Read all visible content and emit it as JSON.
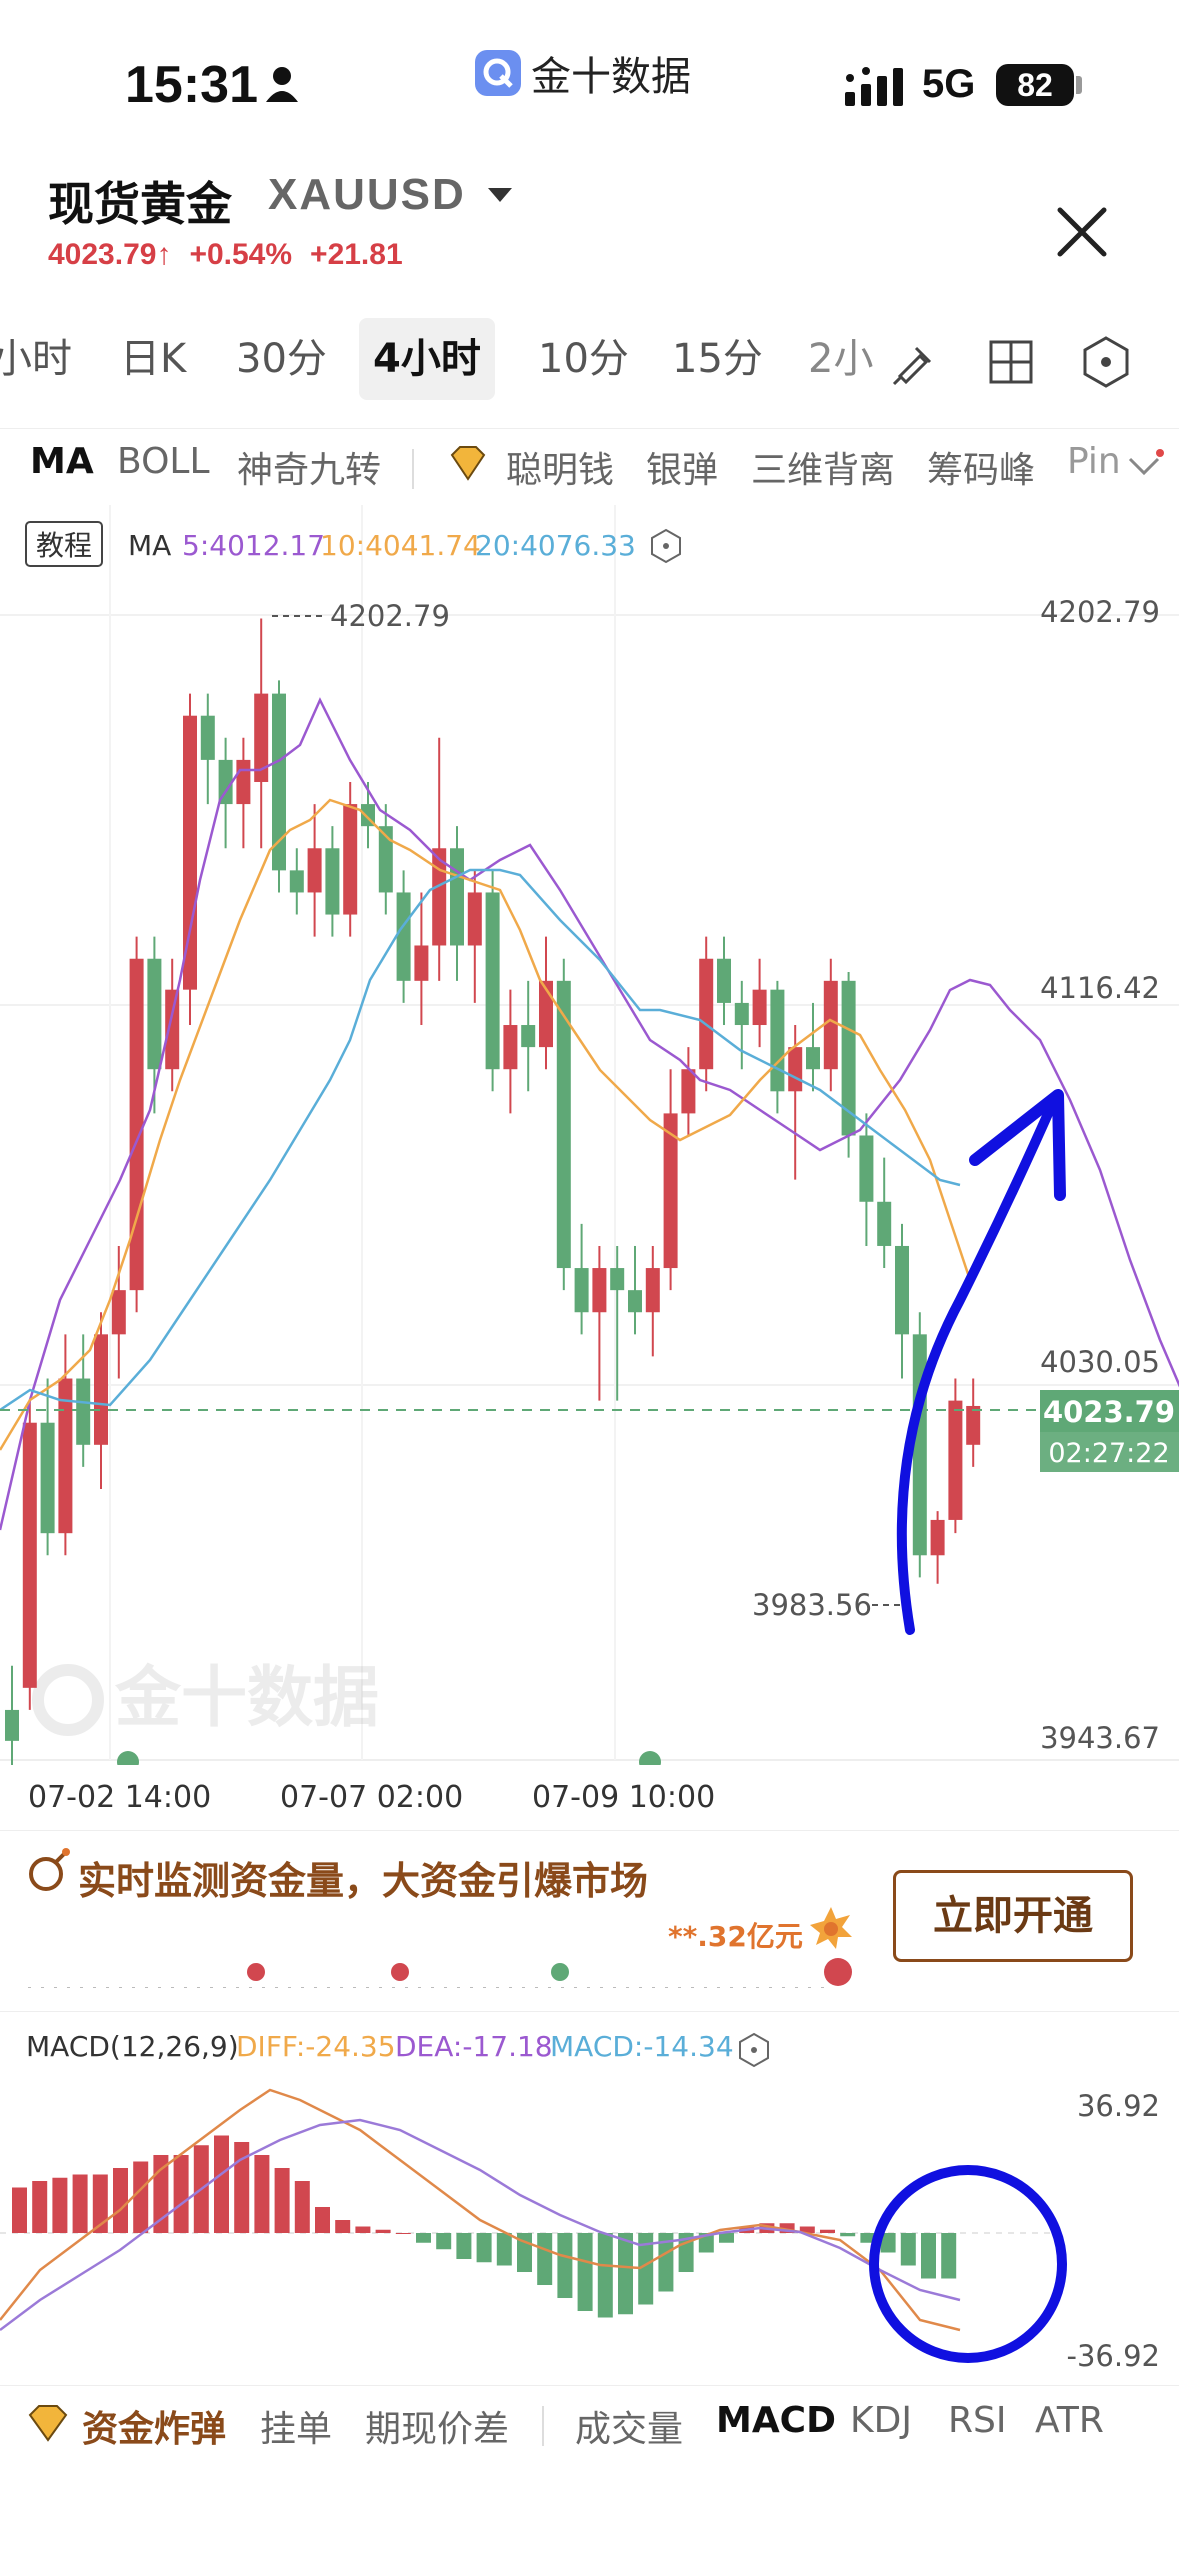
{
  "status": {
    "time": "15:31",
    "network": "5G",
    "battery": "82"
  },
  "app": {
    "name": "金十数据"
  },
  "header": {
    "title": "现货黄金",
    "symbol": "XAUUSD",
    "price": "4023.79",
    "change_pct": "+0.54%",
    "change_abs": "+21.81"
  },
  "period_tabs": [
    "小时",
    "日K",
    "30分",
    "4小时",
    "10分",
    "15分",
    "2小"
  ],
  "active_period": "4小时",
  "indicator_tabs": [
    "MA",
    "BOLL",
    "神奇九转",
    "聪明钱",
    "银弹",
    "三维背离",
    "筹码峰",
    "Pin"
  ],
  "ma_legend": {
    "tutorial": "教程",
    "label": "MA",
    "ma5": "5:4012.17",
    "ma10": "10:4041.74",
    "ma20": "20:4076.33"
  },
  "price_axis": [
    "4202.79",
    "4116.42",
    "4030.05",
    "3943.67"
  ],
  "high_marker": "4202.79",
  "low_marker": "3983.56",
  "current_price_tag": "4023.79",
  "countdown_tag": "02:27:22",
  "watermark": "金十数据",
  "x_axis": [
    "07-02 14:00",
    "07-07 02:00",
    "07-09 10:00"
  ],
  "promo": {
    "text": "实时监测资金量，大资金引爆市场",
    "amount": "**.32亿元",
    "button": "立即开通"
  },
  "macd_legend": {
    "label": "MACD(12,26,9)",
    "diff": "DIFF:-24.35",
    "dea": "DEA:-17.18",
    "macd": "MACD:-14.34"
  },
  "macd_axis": [
    "36.92",
    "-36.92"
  ],
  "bottom_tabs": [
    "资金炸弹",
    "挂单",
    "期现价差",
    "成交量",
    "MACD",
    "KDJ",
    "RSI",
    "ATR"
  ],
  "colors": {
    "up": "#d1474f",
    "down": "#5fa876",
    "ma5": "#9b59d0",
    "ma10": "#f0a94a",
    "ma20": "#5aaed8",
    "annotation": "#1010e0"
  },
  "chart_data": {
    "type": "candlestick",
    "ylim": [
      3943.67,
      4202.79
    ],
    "candles": [
      {
        "o": 3955,
        "h": 3965,
        "l": 3935,
        "c": 3948
      },
      {
        "o": 3960,
        "h": 4025,
        "l": 3955,
        "c": 4020
      },
      {
        "o": 4020,
        "h": 4030,
        "l": 3990,
        "c": 3995
      },
      {
        "o": 3995,
        "h": 4040,
        "l": 3990,
        "c": 4030
      },
      {
        "o": 4030,
        "h": 4040,
        "l": 4010,
        "c": 4015
      },
      {
        "o": 4015,
        "h": 4045,
        "l": 4005,
        "c": 4040
      },
      {
        "o": 4040,
        "h": 4060,
        "l": 4030,
        "c": 4050
      },
      {
        "o": 4050,
        "h": 4130,
        "l": 4045,
        "c": 4125
      },
      {
        "o": 4125,
        "h": 4130,
        "l": 4090,
        "c": 4100
      },
      {
        "o": 4100,
        "h": 4125,
        "l": 4095,
        "c": 4118
      },
      {
        "o": 4118,
        "h": 4185,
        "l": 4110,
        "c": 4180
      },
      {
        "o": 4180,
        "h": 4185,
        "l": 4160,
        "c": 4170
      },
      {
        "o": 4170,
        "h": 4175,
        "l": 4150,
        "c": 4160
      },
      {
        "o": 4160,
        "h": 4175,
        "l": 4150,
        "c": 4170
      },
      {
        "o": 4165,
        "h": 4202,
        "l": 4150,
        "c": 4185
      },
      {
        "o": 4185,
        "h": 4188,
        "l": 4140,
        "c": 4145
      },
      {
        "o": 4145,
        "h": 4150,
        "l": 4135,
        "c": 4140
      },
      {
        "o": 4140,
        "h": 4160,
        "l": 4130,
        "c": 4150
      },
      {
        "o": 4150,
        "h": 4155,
        "l": 4130,
        "c": 4135
      },
      {
        "o": 4135,
        "h": 4165,
        "l": 4130,
        "c": 4160
      },
      {
        "o": 4160,
        "h": 4165,
        "l": 4150,
        "c": 4155
      },
      {
        "o": 4155,
        "h": 4160,
        "l": 4135,
        "c": 4140
      },
      {
        "o": 4140,
        "h": 4145,
        "l": 4115,
        "c": 4120
      },
      {
        "o": 4120,
        "h": 4140,
        "l": 4110,
        "c": 4128
      },
      {
        "o": 4128,
        "h": 4175,
        "l": 4120,
        "c": 4150
      },
      {
        "o": 4150,
        "h": 4155,
        "l": 4120,
        "c": 4128
      },
      {
        "o": 4128,
        "h": 4145,
        "l": 4115,
        "c": 4140
      },
      {
        "o": 4140,
        "h": 4145,
        "l": 4095,
        "c": 4100
      },
      {
        "o": 4100,
        "h": 4118,
        "l": 4090,
        "c": 4110
      },
      {
        "o": 4110,
        "h": 4120,
        "l": 4095,
        "c": 4105
      },
      {
        "o": 4105,
        "h": 4130,
        "l": 4100,
        "c": 4120
      },
      {
        "o": 4120,
        "h": 4125,
        "l": 4050,
        "c": 4055
      },
      {
        "o": 4055,
        "h": 4065,
        "l": 4040,
        "c": 4045
      },
      {
        "o": 4045,
        "h": 4060,
        "l": 4025,
        "c": 4055
      },
      {
        "o": 4055,
        "h": 4060,
        "l": 4025,
        "c": 4050
      },
      {
        "o": 4050,
        "h": 4060,
        "l": 4040,
        "c": 4045
      },
      {
        "o": 4045,
        "h": 4060,
        "l": 4035,
        "c": 4055
      },
      {
        "o": 4055,
        "h": 4100,
        "l": 4050,
        "c": 4090
      },
      {
        "o": 4090,
        "h": 4105,
        "l": 4085,
        "c": 4100
      },
      {
        "o": 4100,
        "h": 4130,
        "l": 4095,
        "c": 4125
      },
      {
        "o": 4125,
        "h": 4130,
        "l": 4110,
        "c": 4115
      },
      {
        "o": 4115,
        "h": 4120,
        "l": 4100,
        "c": 4110
      },
      {
        "o": 4110,
        "h": 4125,
        "l": 4105,
        "c": 4118
      },
      {
        "o": 4118,
        "h": 4120,
        "l": 4090,
        "c": 4095
      },
      {
        "o": 4095,
        "h": 4110,
        "l": 4075,
        "c": 4105
      },
      {
        "o": 4105,
        "h": 4115,
        "l": 4095,
        "c": 4100
      },
      {
        "o": 4100,
        "h": 4125,
        "l": 4095,
        "c": 4120
      },
      {
        "o": 4120,
        "h": 4122,
        "l": 4080,
        "c": 4085
      },
      {
        "o": 4085,
        "h": 4090,
        "l": 4060,
        "c": 4070
      },
      {
        "o": 4070,
        "h": 4080,
        "l": 4055,
        "c": 4060
      },
      {
        "o": 4060,
        "h": 4065,
        "l": 4030,
        "c": 4040
      },
      {
        "o": 4040,
        "h": 4045,
        "l": 3985,
        "c": 3990
      },
      {
        "o": 3990,
        "h": 4000,
        "l": 3983.56,
        "c": 3998
      },
      {
        "o": 3998,
        "h": 4030,
        "l": 3995,
        "c": 4025
      },
      {
        "o": 4015,
        "h": 4030,
        "l": 4010,
        "c": 4023.79
      }
    ],
    "ma5": [
      3960,
      3975,
      3990,
      4000,
      4015,
      4030,
      4060,
      4090,
      4120,
      4140,
      4165,
      4180,
      4175,
      4165,
      4160,
      4150,
      4140,
      4140,
      4145,
      4150,
      4145,
      4140,
      4130,
      4125,
      4120,
      4115,
      4095,
      4080,
      4065,
      4060,
      4060,
      4080,
      4100,
      4110,
      4115,
      4112,
      4108,
      4105,
      4102,
      4098,
      4090,
      4078,
      4065,
      4050,
      4035,
      4012
    ],
    "macd_hist": [
      14,
      16,
      17,
      18,
      18,
      20,
      22,
      24,
      24,
      27,
      30,
      28,
      24,
      20,
      16,
      8,
      4,
      2,
      1,
      0,
      -3,
      -5,
      -8,
      -9,
      -10,
      -12,
      -16,
      -20,
      -24,
      -26,
      -25,
      -22,
      -18,
      -12,
      -6,
      -3,
      2,
      3,
      3,
      2,
      1,
      -1,
      -3,
      -6,
      -10,
      -14,
      -14
    ],
    "macd_range": [
      -36.92,
      36.92
    ]
  }
}
